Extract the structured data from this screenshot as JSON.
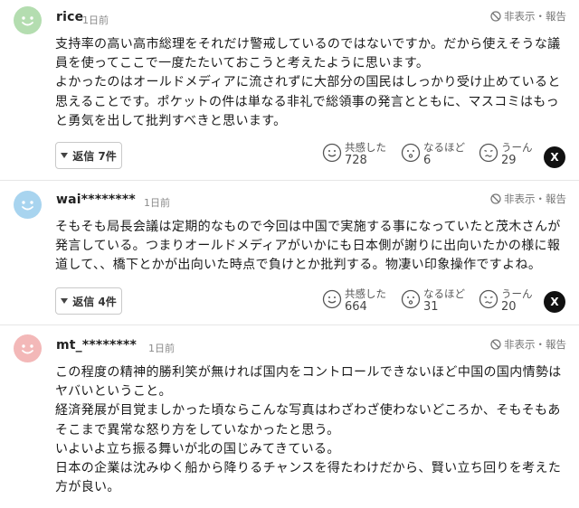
{
  "comments": [
    {
      "user": "rice",
      "time": "1日前",
      "avatar_color": "#b4ddb0",
      "report": "非表示・報告",
      "lines": [
        "支持率の高い高市総理をそれだけ警戒しているのではないですか。だから使えそうな議",
        "員を使ってここで一度たたいておこうと考えたように思います。",
        "よかったのはオールドメディアに流されずに大部分の国民はしっかり受け止めていると",
        "思えることです。ポケットの件は単なる非礼で総領事の発言とともに、マスコミはもっ",
        "と勇気を出して批判すべきと思います。"
      ],
      "reply_label": "返信 7件",
      "reactions": [
        {
          "label": "共感した",
          "count": "728",
          "icon": "smile-face-icon"
        },
        {
          "label": "なるほど",
          "count": "6",
          "icon": "thinking-face-icon"
        },
        {
          "label": "うーん",
          "count": "29",
          "icon": "confused-face-icon"
        }
      ],
      "share": "X"
    },
    {
      "user": "wai********",
      "time": "1日前",
      "avatar_color": "#a8d4ef",
      "report": "非表示・報告",
      "lines": [
        "そもそも局長会議は定期的なもので今回は中国で実施する事になっていたと茂木さんが",
        "発言している。つまりオールドメディアがいかにも日本側が謝りに出向いたかの様に報",
        "道して、、橋下とかが出向いた時点で負けとか批判する。物凄い印象操作ですよね。"
      ],
      "reply_label": "返信 4件",
      "reactions": [
        {
          "label": "共感した",
          "count": "664",
          "icon": "smile-face-icon"
        },
        {
          "label": "なるほど",
          "count": "31",
          "icon": "thinking-face-icon"
        },
        {
          "label": "うーん",
          "count": "20",
          "icon": "confused-face-icon"
        }
      ],
      "share": "X"
    },
    {
      "user": "mt_********",
      "time": "1日前",
      "avatar_color": "#f3b8b8",
      "report": "非表示・報告",
      "lines": [
        "この程度の精神的勝利笑が無ければ国内をコントロールできないほど中国の国内情勢は",
        "ヤバいということ。",
        "経済発展が目覚ましかった頃ならこんな写真はわざわざ使わないどころか、そもそもあ",
        "そこまで異常な怒り方をしていなかったと思う。",
        "いよいよ立ち振る舞いが北の国じみてきている。",
        "日本の企業は沈みゆく船から降りるチャンスを得たわけだから、賢い立ち回りを考えた",
        "方が良い。"
      ]
    }
  ]
}
